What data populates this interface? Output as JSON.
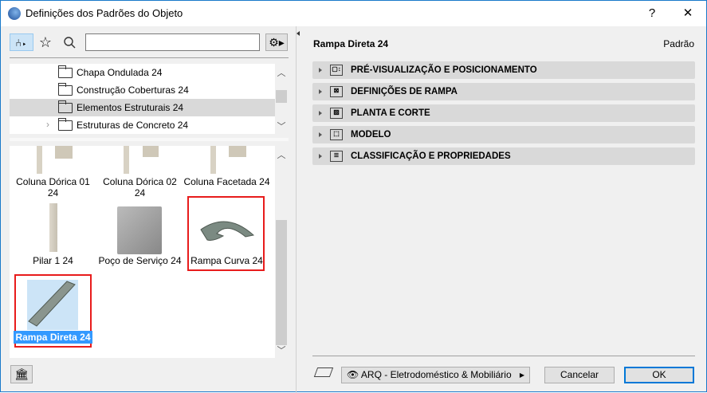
{
  "window": {
    "title": "Definições dos Padrões do Objeto",
    "help": "?",
    "close": "✕"
  },
  "toolbar": {
    "search_value": "",
    "search_placeholder": ""
  },
  "tree": {
    "items": [
      {
        "label": "Chapa Ondulada 24",
        "selected": false,
        "expandable": false
      },
      {
        "label": "Construção Coberturas 24",
        "selected": false,
        "expandable": false
      },
      {
        "label": "Elementos Estruturais 24",
        "selected": true,
        "expandable": false
      },
      {
        "label": "Estruturas de Concreto 24",
        "selected": false,
        "expandable": true
      }
    ]
  },
  "objects": [
    {
      "label": "Coluna Dórica 01 24"
    },
    {
      "label": "Coluna Dórica 02 24"
    },
    {
      "label": "Coluna Facetada 24"
    },
    {
      "label": "Pilar 1 24"
    },
    {
      "label": "Poço de Serviço 24"
    },
    {
      "label": "Rampa Curva 24"
    },
    {
      "label": "Rampa Direta 24",
      "selected": true
    }
  ],
  "right": {
    "object_name": "Rampa Direta 24",
    "status": "Padrão",
    "sections": [
      {
        "label": "PRÉ-VISUALIZAÇÃO E POSICIONAMENTO",
        "icon": "preview-icon"
      },
      {
        "label": "DEFINIÇÕES DE RAMPA",
        "icon": "ramp-settings-icon"
      },
      {
        "label": "PLANTA E CORTE",
        "icon": "floor-plan-icon"
      },
      {
        "label": "MODELO",
        "icon": "model-icon"
      },
      {
        "label": "CLASSIFICAÇÃO E PROPRIEDADES",
        "icon": "classification-icon"
      }
    ]
  },
  "footer": {
    "layer": "ARQ - Eletrodoméstico & Mobiliário",
    "cancel": "Cancelar",
    "ok": "OK"
  },
  "colors": {
    "accent": "#0078d7",
    "highlight": "#cce4f7",
    "selection": "#3399ff",
    "red": "#e81c1c"
  }
}
